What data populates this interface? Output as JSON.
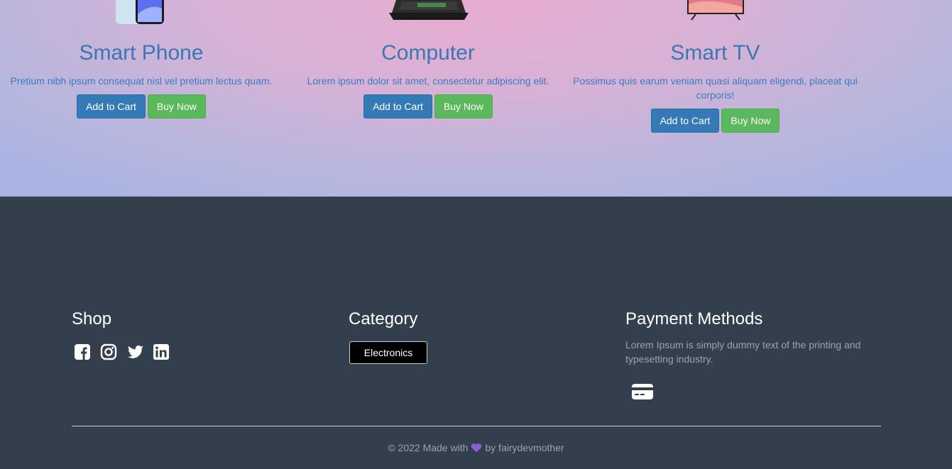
{
  "products": [
    {
      "title": "Smart Phone",
      "desc": "Pretium nibh ipsum consequat nisl vel pretium lectus quam.",
      "cart_label": "Add to Cart",
      "buy_label": "Buy Now",
      "image_icon": "smartphone-image"
    },
    {
      "title": "Computer",
      "desc": "Lorem ipsum dolor sit amet, consectetur adipiscing elit.",
      "cart_label": "Add to Cart",
      "buy_label": "Buy Now",
      "image_icon": "laptop-image"
    },
    {
      "title": "Smart TV",
      "desc": "Possimus quis earum veniam quasi aliquam eligendi, placeat qui corporis!",
      "cart_label": "Add to Cart",
      "buy_label": "Buy Now",
      "image_icon": "tv-image"
    }
  ],
  "footer": {
    "shop": {
      "title": "Shop",
      "icons": [
        "facebook-icon",
        "instagram-icon",
        "twitter-icon",
        "linkedin-icon"
      ]
    },
    "category": {
      "title": "Category",
      "button_label": "Electronics"
    },
    "payment": {
      "title": "Payment Methods",
      "text": "Lorem Ipsum is simply dummy text of the printing and typesetting industry.",
      "icon": "credit-card-icon"
    },
    "copyright": {
      "before": "© 2022 Made with",
      "after": "by fairydevmother",
      "heart_color": "#8a5cd6"
    }
  },
  "colors": {
    "cart": "#337ab7",
    "buy": "#5cb85c",
    "title": "#3a77b3",
    "footer_bg": "#343f4d"
  }
}
